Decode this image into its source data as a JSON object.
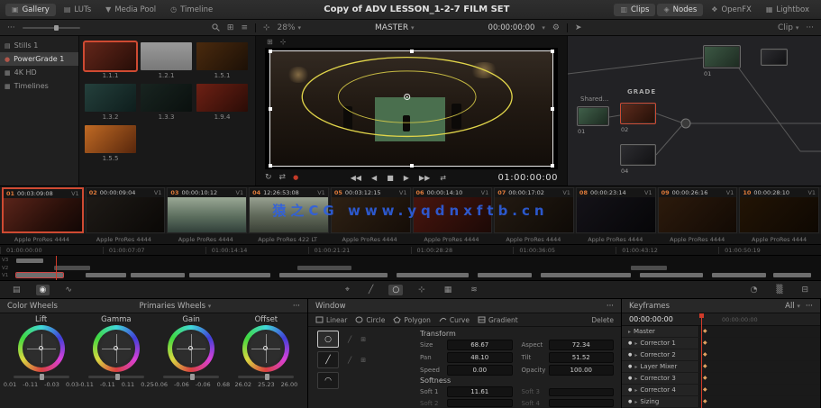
{
  "icons": {
    "ellipsis": "···",
    "chevron": "▾",
    "gear": "⚙",
    "pointer": "➤",
    "grid": "⊞",
    "list": "≡",
    "loop": "↻",
    "swap": "⇄",
    "prev": "◀◀",
    "back": "◀",
    "stop": "■",
    "play": "▶",
    "next": "▶▶",
    "gallery": "▣",
    "luts": "▤",
    "media": "▼",
    "timeline": "◷",
    "clips": "▥",
    "nodes": "◈",
    "openfx": "❖",
    "lightbox": "▦",
    "dot": "●",
    "diamond": "◆",
    "caret": "▸",
    "plus": "⊹",
    "target": "⌖",
    "circle": "○",
    "line": "╱",
    "arc": "◠"
  },
  "topbar": {
    "title": "Copy of ADV LESSON_1-2-7 FILM SET",
    "tabs_left": [
      {
        "label": "Gallery"
      },
      {
        "label": "LUTs"
      },
      {
        "label": "Media Pool"
      },
      {
        "label": "Timeline"
      }
    ],
    "tabs_right": [
      {
        "label": "Clips"
      },
      {
        "label": "Nodes"
      },
      {
        "label": "OpenFX"
      },
      {
        "label": "Lightbox"
      }
    ]
  },
  "subbar": {
    "zoom": "28%",
    "master": "MASTER",
    "timecode": "00:00:00:00",
    "clip": "Clip"
  },
  "gallery": {
    "items": [
      {
        "label": "Stills 1"
      },
      {
        "label": "PowerGrade 1"
      },
      {
        "label": "4K HD"
      },
      {
        "label": "Timelines"
      }
    ],
    "thumbs": [
      {
        "label": "1.1.1"
      },
      {
        "label": "1.2.1"
      },
      {
        "label": "1.5.1"
      },
      {
        "label": "1.3.2"
      },
      {
        "label": "1.3.3"
      },
      {
        "label": "1.9.4"
      },
      {
        "label": "1.5.5"
      }
    ]
  },
  "viewer": {
    "timecode": "01:00:00:00"
  },
  "nodes": {
    "shared": "Shared...",
    "grade": "GRADE",
    "labels": [
      "01",
      "02",
      "04",
      "01"
    ]
  },
  "clips": [
    {
      "num": "01",
      "tc": "00:03:09:08",
      "track": "V1",
      "format": "Apple ProRes 4444"
    },
    {
      "num": "02",
      "tc": "00:00:09:04",
      "track": "V1",
      "format": "Apple ProRes 4444"
    },
    {
      "num": "03",
      "tc": "00:00:10:12",
      "track": "V1",
      "format": "Apple ProRes 4444"
    },
    {
      "num": "04",
      "tc": "12:26:53:08",
      "track": "V1",
      "format": "Apple ProRes 422 LT"
    },
    {
      "num": "05",
      "tc": "00:03:12:15",
      "track": "V1",
      "format": "Apple ProRes 4444"
    },
    {
      "num": "06",
      "tc": "00:00:14:10",
      "track": "V1",
      "format": "Apple ProRes 4444"
    },
    {
      "num": "07",
      "tc": "00:00:17:02",
      "track": "V1",
      "format": "Apple ProRes 4444"
    },
    {
      "num": "08",
      "tc": "00:00:23:14",
      "track": "V1",
      "format": "Apple ProRes 4444"
    },
    {
      "num": "09",
      "tc": "00:00:26:16",
      "track": "V1",
      "format": "Apple ProRes 4444"
    },
    {
      "num": "10",
      "tc": "00:00:28:10",
      "track": "V1",
      "format": "Apple ProRes 4444"
    }
  ],
  "watermark": "猿之CG  www.yqdnxftb.cn",
  "ruler": [
    "01:00:00:00",
    "01:00:07:07",
    "01:00:14:14",
    "01:00:21:21",
    "01:00:28:28",
    "01:00:36:05",
    "01:00:43:12",
    "01:00:50:19"
  ],
  "tracks": [
    "V3",
    "V2",
    "V1"
  ],
  "tools": [
    "▤",
    "◉",
    "∿",
    "⌖",
    "╱",
    "○",
    "⊹",
    "▦",
    "≋",
    "◔",
    "▒",
    "⊟"
  ],
  "wheels": {
    "title": "Color Wheels",
    "mode": "Primaries Wheels",
    "items": [
      {
        "name": "Lift",
        "values": [
          "0.01",
          "-0.11",
          "-0.03",
          "0.03"
        ]
      },
      {
        "name": "Gamma",
        "values": [
          "-0.11",
          "-0.11",
          "0.11",
          "0.25"
        ]
      },
      {
        "name": "Gain",
        "values": [
          "-0.06",
          "-0.06",
          "-0.06",
          "0.68"
        ]
      },
      {
        "name": "Offset",
        "values": [
          "26.02",
          "25.23",
          "26.00"
        ]
      }
    ]
  },
  "window": {
    "title": "Window",
    "shapes": [
      "Linear",
      "Circle",
      "Polygon",
      "Curve",
      "Gradient"
    ],
    "delete": "Delete",
    "transform": "Transform",
    "fields": [
      {
        "label": "Size",
        "value": "68.67"
      },
      {
        "label": "Aspect",
        "value": "72.34"
      },
      {
        "label": "Pan",
        "value": "48.10"
      },
      {
        "label": "Tilt",
        "value": "51.52"
      },
      {
        "label": "Speed",
        "value": "0.00"
      },
      {
        "label": "Opacity",
        "value": "100.00"
      }
    ],
    "softness": "Softness",
    "soft": [
      {
        "label": "Soft 1",
        "value": "11.61"
      },
      {
        "label": "Soft 2",
        "value": ""
      },
      {
        "label": "Soft 3",
        "value": ""
      },
      {
        "label": "Soft 4",
        "value": ""
      }
    ]
  },
  "keyframes": {
    "title": "Keyframes",
    "all": "All",
    "timecode": "00:00:00:00",
    "timecode2": "00:00:00:00",
    "rows": [
      "Master",
      "Corrector 1",
      "Corrector 2",
      "Layer Mixer",
      "Corrector 3",
      "Corrector 4",
      "Sizing"
    ]
  }
}
